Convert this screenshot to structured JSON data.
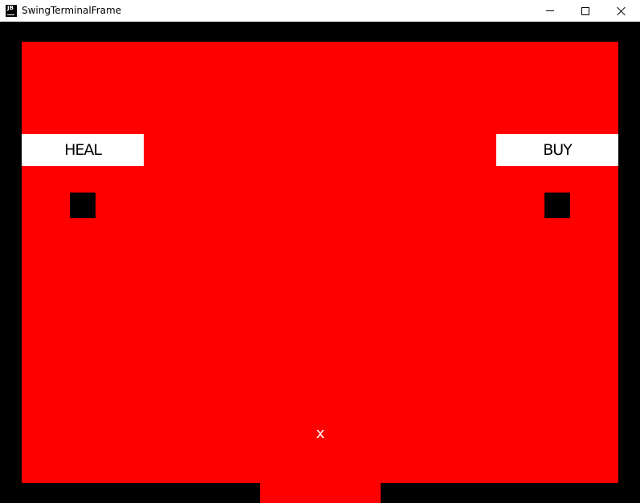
{
  "window": {
    "app_icon_text": "JB",
    "title": "SwingTerminalFrame",
    "icons": {
      "minimize": "minimize-icon",
      "maximize": "maximize-icon",
      "close": "close-icon"
    }
  },
  "game": {
    "colors": {
      "background": "#000000",
      "room": "#ff0000",
      "sign": "#ffffff",
      "player": "#ffffff"
    },
    "signs": {
      "heal": "HEAL",
      "buy": "BUY"
    },
    "player_glyph": "x"
  }
}
